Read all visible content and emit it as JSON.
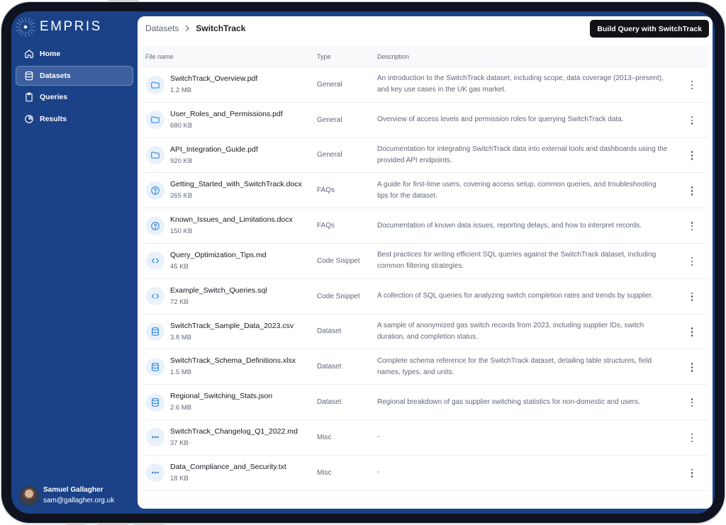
{
  "brand": {
    "name": "EMPRIS"
  },
  "nav": {
    "items": [
      {
        "label": "Home",
        "icon": "home-icon"
      },
      {
        "label": "Datasets",
        "icon": "database-icon",
        "active": true
      },
      {
        "label": "Queries",
        "icon": "clipboard-icon"
      },
      {
        "label": "Results",
        "icon": "pie-chart-icon"
      }
    ]
  },
  "user": {
    "name": "Samuel Gallagher",
    "email": "sam@gallagher.org.uk"
  },
  "header": {
    "breadcrumb_parent": "Datasets",
    "breadcrumb_current": "SwitchTrack",
    "action_label": "Build Query with SwitchTrack"
  },
  "table": {
    "columns": {
      "name": "File name",
      "type": "Type",
      "description": "Description"
    },
    "rows": [
      {
        "name": "SwitchTrack_Overview.pdf",
        "size": "1.2 MB",
        "type": "General",
        "icon": "folder-icon",
        "description": "An introduction to the SwitchTrack dataset, including scope, data coverage (2013–present), and key use cases in the UK gas market."
      },
      {
        "name": "User_Roles_and_Permissions.pdf",
        "size": "680 KB",
        "type": "General",
        "icon": "folder-icon",
        "description": "Overview of access levels and permission roles for querying SwitchTrack data."
      },
      {
        "name": "API_Integration_Guide.pdf",
        "size": "920 KB",
        "type": "General",
        "icon": "folder-icon",
        "description": "Documentation for integrating SwitchTrack data into external tools and dashboards using the provided API endpoints."
      },
      {
        "name": "Getting_Started_with_SwitchTrack.docx",
        "size": "265 KB",
        "type": "FAQs",
        "icon": "question-icon",
        "description": "A guide for first-time users, covering access setup, common queries, and troubleshooting tips for the dataset."
      },
      {
        "name": "Known_Issues_and_Limitations.docx",
        "size": "150 KB",
        "type": "FAQs",
        "icon": "question-icon",
        "description": "Documentation of known data issues, reporting delays, and how to interpret records."
      },
      {
        "name": "Query_Optimization_Tips.md",
        "size": "45 KB",
        "type": "Code Snippet",
        "icon": "code-icon",
        "description": "Best practices for writing efficient SQL queries against the SwitchTrack dataset, including common filtering strategies."
      },
      {
        "name": "Example_Switch_Queries.sql",
        "size": "72 KB",
        "type": "Code Snippet",
        "icon": "code-icon",
        "description": "A collection of SQL queries for analyzing switch completion rates and trends by supplier."
      },
      {
        "name": "SwitchTrack_Sample_Data_2023.csv",
        "size": "3.8 MB",
        "type": "Dataset",
        "icon": "database-icon",
        "description": "A sample of anonymized gas switch records from 2023, including supplier IDs, switch duration, and completion status."
      },
      {
        "name": "SwitchTrack_Schema_Definitions.xlsx",
        "size": "1.5 MB",
        "type": "Dataset",
        "icon": "database-icon",
        "description": "Complete schema reference for the SwitchTrack dataset, detailing table structures, field names, types, and units."
      },
      {
        "name": "Regional_Switching_Stats.json",
        "size": "2.6 MB",
        "type": "Dataset",
        "icon": "database-icon",
        "description": "Regional breakdown of gas supplier switching statistics for non-domestic and users."
      },
      {
        "name": "SwitchTrack_Changelog_Q1_2022.md",
        "size": "37 KB",
        "type": "Misc",
        "icon": "more-horizontal-icon",
        "description": "-"
      },
      {
        "name": "Data_Compliance_and_Security.txt",
        "size": "18 KB",
        "type": "Misc",
        "icon": "more-horizontal-icon",
        "description": "-"
      }
    ]
  },
  "colors": {
    "sidebar": "#1b4287",
    "active_nav": "#3d5f9f",
    "primary_button": "#111216",
    "icon_tint": "#2f8ae0",
    "icon_bg": "#eaf1fb"
  }
}
